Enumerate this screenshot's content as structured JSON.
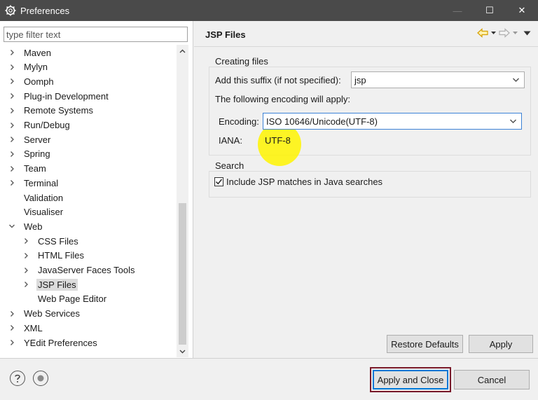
{
  "window": {
    "title": "Preferences",
    "controls": {
      "minimize": "—",
      "maximize": "☐",
      "close": "✕"
    }
  },
  "filter": {
    "placeholder": "type filter text",
    "value": ""
  },
  "tree": {
    "items": [
      {
        "label": "Maven",
        "expandable": true,
        "expanded": false,
        "level": 0
      },
      {
        "label": "Mylyn",
        "expandable": true,
        "expanded": false,
        "level": 0
      },
      {
        "label": "Oomph",
        "expandable": true,
        "expanded": false,
        "level": 0
      },
      {
        "label": "Plug-in Development",
        "expandable": true,
        "expanded": false,
        "level": 0
      },
      {
        "label": "Remote Systems",
        "expandable": true,
        "expanded": false,
        "level": 0
      },
      {
        "label": "Run/Debug",
        "expandable": true,
        "expanded": false,
        "level": 0
      },
      {
        "label": "Server",
        "expandable": true,
        "expanded": false,
        "level": 0
      },
      {
        "label": "Spring",
        "expandable": true,
        "expanded": false,
        "level": 0
      },
      {
        "label": "Team",
        "expandable": true,
        "expanded": false,
        "level": 0
      },
      {
        "label": "Terminal",
        "expandable": true,
        "expanded": false,
        "level": 0
      },
      {
        "label": "Validation",
        "expandable": false,
        "level": 0
      },
      {
        "label": "Visualiser",
        "expandable": false,
        "level": 0
      },
      {
        "label": "Web",
        "expandable": true,
        "expanded": true,
        "level": 0
      },
      {
        "label": "CSS Files",
        "expandable": true,
        "expanded": false,
        "level": 1
      },
      {
        "label": "HTML Files",
        "expandable": true,
        "expanded": false,
        "level": 1
      },
      {
        "label": "JavaServer Faces Tools",
        "expandable": true,
        "expanded": false,
        "level": 1
      },
      {
        "label": "JSP Files",
        "expandable": true,
        "expanded": false,
        "level": 1,
        "selected": true
      },
      {
        "label": "Web Page Editor",
        "expandable": false,
        "level": 1
      },
      {
        "label": "Web Services",
        "expandable": true,
        "expanded": false,
        "level": 0
      },
      {
        "label": "XML",
        "expandable": true,
        "expanded": false,
        "level": 0
      },
      {
        "label": "YEdit Preferences",
        "expandable": true,
        "expanded": false,
        "level": 0
      }
    ]
  },
  "page": {
    "title": "JSP Files",
    "creating_files": {
      "group_label": "Creating files",
      "suffix_label": "Add this suffix (if not specified):",
      "suffix_value": "jsp",
      "encoding_note": "The following encoding will apply:",
      "encoding_label": "Encoding:",
      "encoding_value": "ISO 10646/Unicode(UTF-8)",
      "iana_label": "IANA:",
      "iana_value": "UTF-8"
    },
    "search": {
      "group_label": "Search",
      "include_label": "Include JSP matches in Java searches",
      "include_checked": true
    },
    "restore_defaults_label": "Restore Defaults",
    "apply_label": "Apply"
  },
  "footer": {
    "apply_close_label": "Apply and Close",
    "cancel_label": "Cancel"
  },
  "colors": {
    "titlebar": "#4a4a4a",
    "highlight": "#fff500",
    "focus_ring": "#7a1a2a",
    "default_button_border": "#0078d7"
  }
}
